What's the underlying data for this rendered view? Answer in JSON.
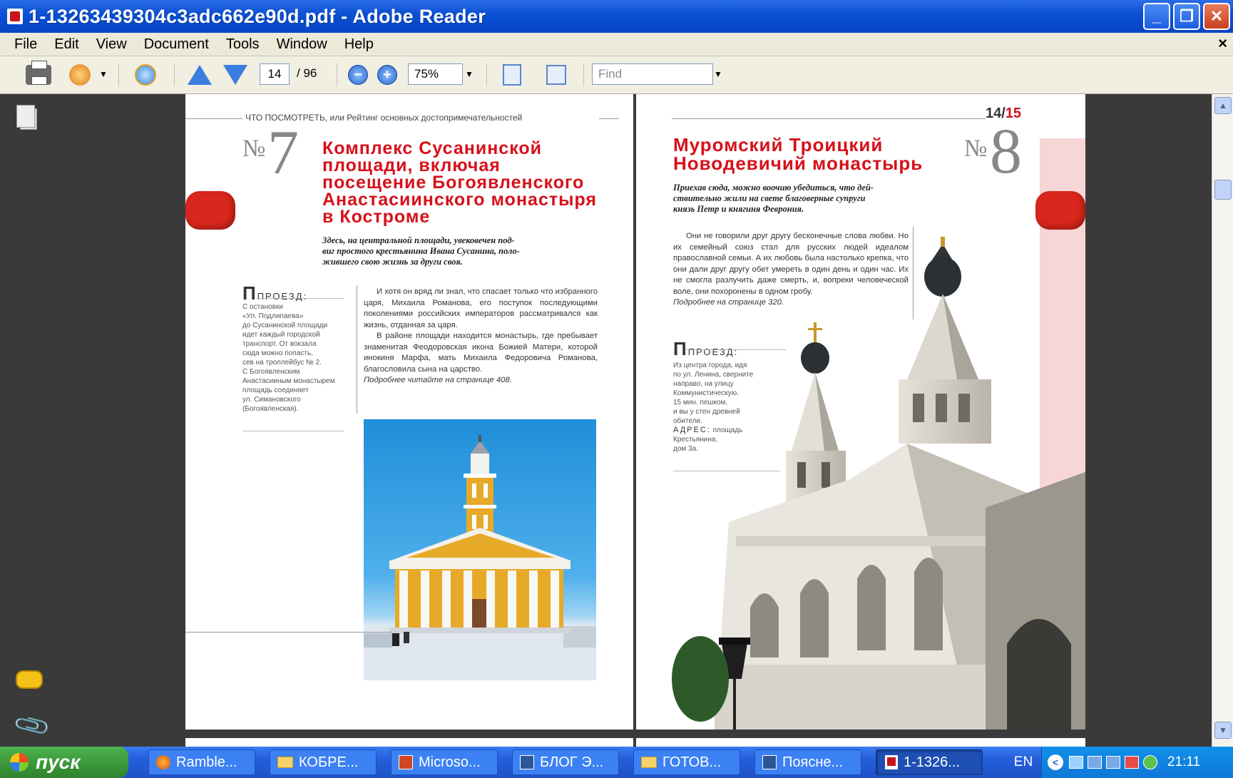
{
  "window": {
    "title": "1-13263439304c3adc662e90d.pdf - Adobe Reader",
    "buttons": [
      "_",
      "❐",
      "✕"
    ]
  },
  "menu": {
    "items": [
      "File",
      "Edit",
      "View",
      "Document",
      "Tools",
      "Window",
      "Help"
    ],
    "close": "×"
  },
  "toolbar": {
    "page_current": "14",
    "page_total": "/ 96",
    "zoom": "75%",
    "find_placeholder": "Find"
  },
  "left_page": {
    "running_head": "ЧТО ПОСМОТРЕТЬ, или Рейтинг основных достопримечательностей",
    "number_sign": "№",
    "number": "7",
    "title_lines": [
      "Комплекс Сусанинской",
      "площади, включая",
      "посещение Богоявленского",
      "Анастасиинского монастыря",
      "в Костроме"
    ],
    "subtitle_lines": [
      "Здесь, на центральной площади, увековечен под-",
      "виг простого крестьянина Ивана Сусанина, поло-",
      "жившего свою жизнь за други своя."
    ],
    "proezd_letter": "П",
    "proezd_label": "ПРОЕЗД:",
    "proezd_lines": [
      "С остановки",
      "«Ул. Подлипаева»",
      "до Сусанинской площади",
      "идет каждый городской",
      "транспорт. От вокзала",
      "сюда можно попасть,",
      "сев на троллейбус № 2.",
      "С Богоявленским",
      "Анастасииным монастырем",
      "площадь соединяет",
      "ул. Симановского",
      "(Богоявленская)."
    ],
    "body_p1": "И хотя он вряд ли знал, что спасает только что избранного царя, Михаила Романова, его поступок последующими поколениями российских императоров рассматривался как жизнь, отданная за царя.",
    "body_p2": "В районе площади находится монастырь, где пребывает знаменитая Феодоровская икона Божией Матери, которой инокиня Марфа, мать Михаила Федоровича Романова, благословила сына на царство.",
    "body_ref": "Подробнее читайте на странице 408."
  },
  "right_page": {
    "page_numbers": {
      "left": "14/",
      "right": "15"
    },
    "number_sign": "№",
    "number": "8",
    "title_lines": [
      "Муромский Троицкий",
      "Новодевичий монастырь"
    ],
    "subtitle_lines": [
      "Приехав сюда, можно воочию убедиться, что дей-",
      "ствительно жили на свете благоверные супруги",
      "князь Петр и княгиня Феврония."
    ],
    "body_p1": "Они не говорили друг другу бесконечные слова любви. Но их семейный союз стал для русских людей идеалом православной семьи. А их любовь была настолько крепка, что они дали друг другу обет умереть в один день и один час. Их не смогла разлучить даже смерть, и, вопреки человеческой воле, они похоронены в одном гробу.",
    "body_ref": "Подробнее на странице 320.",
    "proezd_letter": "П",
    "proezd_label": "ПРОЕЗД:",
    "proezd_lines": [
      "Из центра города, идя",
      "по ул. Ленина, сверните",
      "направо, на улицу",
      "Коммунистическую.",
      "15 мин. пешком,",
      "и вы у стен древней",
      "обители."
    ],
    "address_label": "АДРЕС:",
    "address_value_1": "площадь",
    "address_lines": [
      "Крестьянина,",
      "дом 3а."
    ]
  },
  "taskbar": {
    "start": "пуск",
    "items": [
      "Ramble...",
      "КОБРЕ...",
      "Microso...",
      "БЛОГ Э...",
      "ГОТОВ...",
      "Поясне...",
      "1-1326..."
    ],
    "lang": "EN",
    "clock": "21:11"
  },
  "colors": {
    "titlebar": "#0a4fd4",
    "accent_red": "#d7101a",
    "taskbar": "#245edb",
    "start": "#3c9a3c"
  }
}
